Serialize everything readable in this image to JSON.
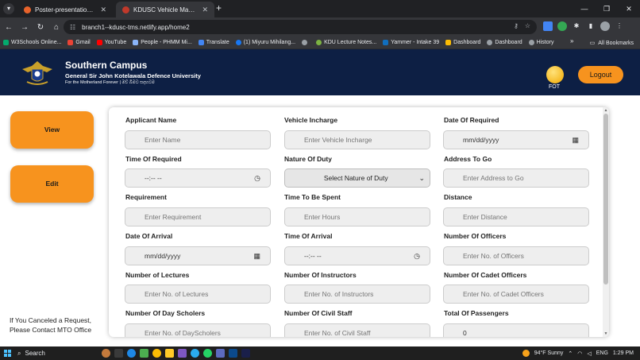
{
  "browser": {
    "tabs": [
      {
        "title": "Poster-presentation_templat.p",
        "active": false,
        "favicon_color": "#e8632b"
      },
      {
        "title": "KDUSC Vehicle Management Sy",
        "active": true,
        "favicon_color": "#c0392b"
      }
    ],
    "tab_close": "✕",
    "new_tab": "+",
    "window_buttons": [
      "—",
      "❐",
      "✕"
    ],
    "url": "branch1--kdusc-tms.netlify.app/home2",
    "bookmarks": [
      {
        "label": "W3Schools Online...",
        "color": "#04aa6d"
      },
      {
        "label": "Gmail",
        "color": "#ea4335"
      },
      {
        "label": "YouTube",
        "color": "#ff0000"
      },
      {
        "label": "People - PHMM Mi...",
        "color": "#8ab4f8"
      },
      {
        "label": "Translate",
        "color": "#4285f4"
      },
      {
        "label": "(1) Miyuru Mihilang...",
        "color": "#1877f2"
      },
      {
        "label": "",
        "color": "#9aa0a6"
      },
      {
        "label": "KDU Lecture Notes...",
        "color": "#7cb342"
      },
      {
        "label": "Yammer - Intake 39",
        "color": "#106ebe"
      },
      {
        "label": "Dashboard",
        "color": "#fbbc04"
      },
      {
        "label": "Dashboard",
        "color": "#9aa0a6"
      },
      {
        "label": "History",
        "color": "#9aa0a6"
      }
    ],
    "bookmarks_more": "»",
    "all_bookmarks": "All Bookmarks"
  },
  "header": {
    "title": "Southern Campus",
    "subtitle": "General Sir John Kotelawala Defence University",
    "motto": "For the Motherland Forever | මව් බිමට සදහටම",
    "user_name": "FOT",
    "logout_label": "Logout",
    "colors": {
      "header_bg": "#0d1f44",
      "accent": "#f7931e"
    }
  },
  "sidebar": {
    "view_label": "View",
    "edit_label": "Edit",
    "notice_line1": "If You Canceled a Request,",
    "notice_line2": "Please Contact MTO Office"
  },
  "form": {
    "fields": [
      {
        "label": "Applicant Name",
        "placeholder": "Enter Name"
      },
      {
        "label": "Vehicle Incharge",
        "placeholder": "Enter Vehicle Incharge"
      },
      {
        "label": "Date Of Required",
        "placeholder": "mm/dd/yyyy",
        "icon": "calendar-icon"
      },
      {
        "label": "Time Of Required",
        "placeholder": "--:-- --",
        "icon": "clock-icon"
      },
      {
        "label": "Nature Of Duty",
        "placeholder": "Select Nature of Duty",
        "type": "select"
      },
      {
        "label": "Address To Go",
        "placeholder": "Enter Address to Go"
      },
      {
        "label": "Requirement",
        "placeholder": "Enter Requirement"
      },
      {
        "label": "Time To Be Spent",
        "placeholder": "Enter Hours"
      },
      {
        "label": "Distance",
        "placeholder": "Enter Distance"
      },
      {
        "label": "Date Of Arrival",
        "placeholder": "mm/dd/yyyy",
        "icon": "calendar-icon"
      },
      {
        "label": "Time Of Arrival",
        "placeholder": "--:-- --",
        "icon": "clock-icon"
      },
      {
        "label": "Number Of Officers",
        "placeholder": "Enter No. of Officers"
      },
      {
        "label": "Number of Lectures",
        "placeholder": "Enter No. of Lectures"
      },
      {
        "label": "Number Of Instructors",
        "placeholder": "Enter No. of Instructors"
      },
      {
        "label": "Number Of Cadet Officers",
        "placeholder": "Enter No. of Cadet Officers"
      },
      {
        "label": "Number Of Day Scholers",
        "placeholder": "Enter No. of DayScholers"
      },
      {
        "label": "Number Of Civil Staff",
        "placeholder": "Enter No. of Civil Staff"
      },
      {
        "label": "Total Of Passengers",
        "value": "0"
      }
    ]
  },
  "taskbar": {
    "search_label": "Search",
    "weather": "94°F  Sunny",
    "language": "ENG",
    "time": "1:29 PM"
  }
}
